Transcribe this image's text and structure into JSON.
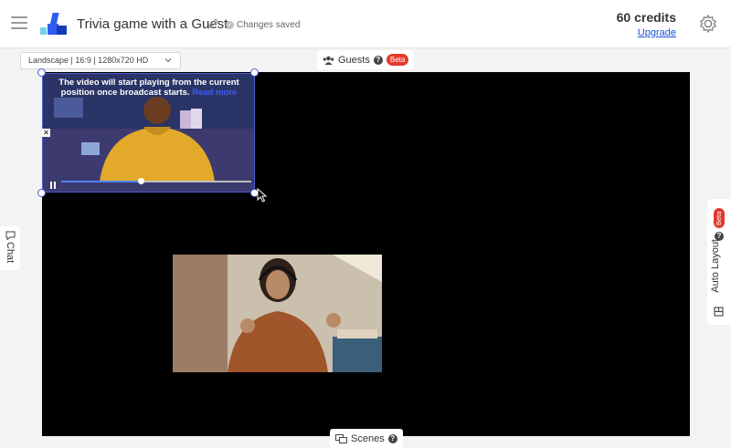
{
  "app": {
    "title": "Trivia game with a Guest",
    "save_status": "Changes saved"
  },
  "account": {
    "credits": "60 credits",
    "upgrade_label": "Upgrade"
  },
  "toolbar": {
    "layout_value": "Landscape | 16:9 | 1280x720 HD",
    "guests_label": "Guests",
    "guests_badge": "Beta"
  },
  "guest_video": {
    "message": "The video will start playing from the current position once broadcast starts.",
    "read_more": "Read more",
    "progress": 0.42
  },
  "side": {
    "chat_label": "Chat",
    "auto_layout_label": "Auto Layout",
    "auto_layout_badge": "Beta"
  },
  "bottom": {
    "scenes_label": "Scenes"
  },
  "colors": {
    "accent": "#1a4fd6",
    "beta": "#e33a2c",
    "canvas": "#000000",
    "selection": "#4c5dd0"
  }
}
